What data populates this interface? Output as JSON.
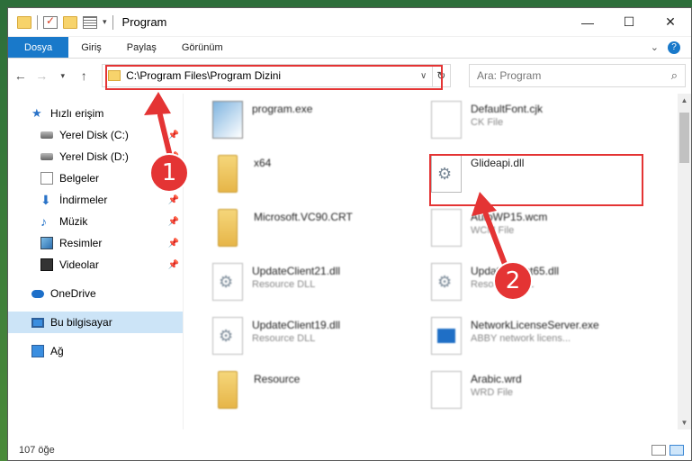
{
  "window": {
    "title": "Program"
  },
  "controls": {
    "minimize": "—",
    "maximize": "☐",
    "close": "✕"
  },
  "ribbon": {
    "tabs": [
      "Dosya",
      "Giriş",
      "Paylaş",
      "Görünüm"
    ],
    "help": "?"
  },
  "address": {
    "path": "C:\\Program Files\\Program Dizini"
  },
  "search": {
    "placeholder": "Ara: Program"
  },
  "sidebar": {
    "quick_access": "Hızlı erişim",
    "items": [
      "Yerel Disk (C:)",
      "Yerel Disk (D:)",
      "Belgeler",
      "İndirmeler",
      "Müzik",
      "Resimler",
      "Videolar"
    ],
    "onedrive": "OneDrive",
    "this_pc": "Bu bilgisayar",
    "network": "Ağ"
  },
  "files": [
    {
      "name": "program.exe",
      "type": "",
      "icon": "exe-icon"
    },
    {
      "name": "DefaultFont.cjk",
      "type": "CK File",
      "icon": "document-icon"
    },
    {
      "name": "x64",
      "type": "",
      "icon": "folder-icon"
    },
    {
      "name": "Glideapi.dll",
      "type": "",
      "icon": "dll-icon"
    },
    {
      "name": "Microsoft.VC90.CRT",
      "type": "",
      "icon": "folder-icon"
    },
    {
      "name": "AutoWP15.wcm",
      "type": "WCM File",
      "icon": "document-icon"
    },
    {
      "name": "UpdateClient21.dll",
      "type": "Resource DLL",
      "icon": "dll-icon"
    },
    {
      "name": "UpdateClient65.dll",
      "type": "Resource DLL",
      "icon": "dll-icon"
    },
    {
      "name": "UpdateClient19.dll",
      "type": "Resource DLL",
      "icon": "dll-icon"
    },
    {
      "name": "NetworkLicenseServer.exe",
      "type": "ABBY network licens...",
      "icon": "network-exe-icon"
    },
    {
      "name": "Resource",
      "type": "",
      "icon": "folder-icon"
    },
    {
      "name": "Arabic.wrd",
      "type": "WRD File",
      "icon": "document-icon"
    }
  ],
  "status": {
    "count": "107 öğe"
  },
  "annotations": {
    "badge1": "1",
    "badge2": "2",
    "color": "#e43434"
  }
}
